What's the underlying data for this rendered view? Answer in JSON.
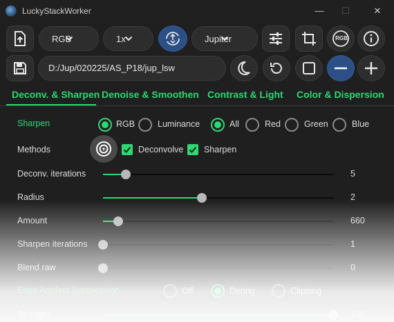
{
  "window": {
    "title": "LuckyStackWorker",
    "minimize": "—",
    "maximize": "☐",
    "close": "✕"
  },
  "toolbar": {
    "color_mode": "RGB",
    "scale": "1x",
    "planet": "Jupiter",
    "rgb_badge": "RGB",
    "path": "D:/Jup/020225/AS_P18/jup_lsw"
  },
  "tabs": [
    {
      "label": "Deconv. & Sharpen",
      "active": true
    },
    {
      "label": "Denoise & Smoothen",
      "active": false
    },
    {
      "label": "Contrast & Light",
      "active": false
    },
    {
      "label": "Color & Dispersion",
      "active": false
    }
  ],
  "sharpen": {
    "label": "Sharpen",
    "mode_options": [
      "RGB",
      "Luminance"
    ],
    "mode_selected": "RGB",
    "channel_options": [
      "All",
      "Red",
      "Green",
      "Blue"
    ],
    "channel_selected": "All"
  },
  "methods": {
    "label": "Methods",
    "options": [
      {
        "label": "Deconvolve",
        "checked": true
      },
      {
        "label": "Sharpen",
        "checked": true
      }
    ]
  },
  "sliders": [
    {
      "label": "Deconv. iterations",
      "value": "5",
      "fraction": 0.1
    },
    {
      "label": "Radius",
      "value": "2",
      "fraction": 0.43
    },
    {
      "label": "Amount",
      "value": "660",
      "fraction": 0.065
    },
    {
      "label": "Sharpen iterations",
      "value": "1",
      "fraction": 0.0
    },
    {
      "label": "Blend raw",
      "value": "0",
      "fraction": 0.0
    }
  ],
  "edge": {
    "label": "Edge Artefact Suppression",
    "options": [
      "Off",
      "Dering",
      "Clipping"
    ],
    "selected": "Dering"
  },
  "strength": {
    "label": "Strength",
    "value": "100",
    "fraction": 1.0
  },
  "colors": {
    "accent": "#2ed873",
    "background": "#1f1f1f",
    "button": "#2d2d2d",
    "blue": "#2c4f86"
  }
}
